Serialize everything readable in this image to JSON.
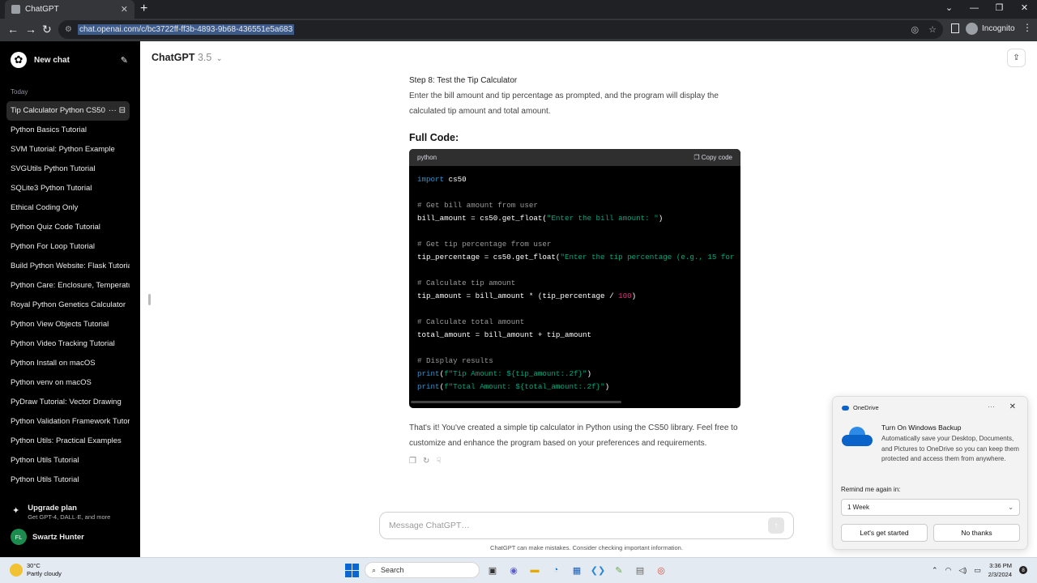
{
  "browser": {
    "tab_title": "ChatGPT",
    "url": "chat.openai.com/c/bc3722ff-ff3b-4893-9b68-436551e5a683",
    "profile_label": "Incognito"
  },
  "sidebar": {
    "new_chat_label": "New chat",
    "section_label": "Today",
    "chats": [
      "Tip Calculator Python CS50",
      "Python Basics Tutorial",
      "SVM Tutorial: Python Example",
      "SVGUtils Python Tutorial",
      "SQLite3 Python Tutorial",
      "Ethical Coding Only",
      "Python Quiz Code Tutorial",
      "Python For Loop Tutorial",
      "Build Python Website: Flask Tutorial",
      "Python Care: Enclosure, Temperature",
      "Royal Python Genetics Calculator",
      "Python View Objects Tutorial",
      "Python Video Tracking Tutorial",
      "Python Install on macOS",
      "Python venv on macOS",
      "PyDraw Tutorial: Vector Drawing",
      "Python Validation Framework Tutorial",
      "Python Utils: Practical Examples",
      "Python Utils Tutorial",
      "Python Utils Tutorial"
    ],
    "upgrade_title": "Upgrade plan",
    "upgrade_subtitle": "Get GPT-4, DALL·E, and more",
    "user_initials": "FL",
    "user_name": "Swartz Hunter"
  },
  "header": {
    "model_name": "ChatGPT",
    "model_version": "3.5"
  },
  "message": {
    "step_title": "Step 8: Test the Tip Calculator",
    "step_text": "Enter the bill amount and tip percentage as prompted, and the program will display the calculated tip amount and total amount.",
    "full_code_heading": "Full Code:",
    "code_lang": "python",
    "copy_label": "Copy code",
    "closing_text": "That's it! You've created a simple tip calculator in Python using the CS50 library. Feel free to customize and enhance the program based on your preferences and requirements."
  },
  "composer": {
    "placeholder": "Message ChatGPT…",
    "disclaimer": "ChatGPT can make mistakes. Consider checking important information."
  },
  "toast": {
    "app_name": "OneDrive",
    "title": "Turn On Windows Backup",
    "body": "Automatically save your Desktop, Documents, and Pictures to OneDrive so you can keep them protected and access them from anywhere.",
    "remind_label": "Remind me again in:",
    "remind_value": "1 Week",
    "primary_button": "Let's get started",
    "secondary_button": "No thanks"
  },
  "taskbar": {
    "temperature": "30°C",
    "weather_desc": "Partly cloudy",
    "search_label": "Search",
    "time": "3:36 PM",
    "date": "2/3/2024",
    "notification_count": "8"
  }
}
